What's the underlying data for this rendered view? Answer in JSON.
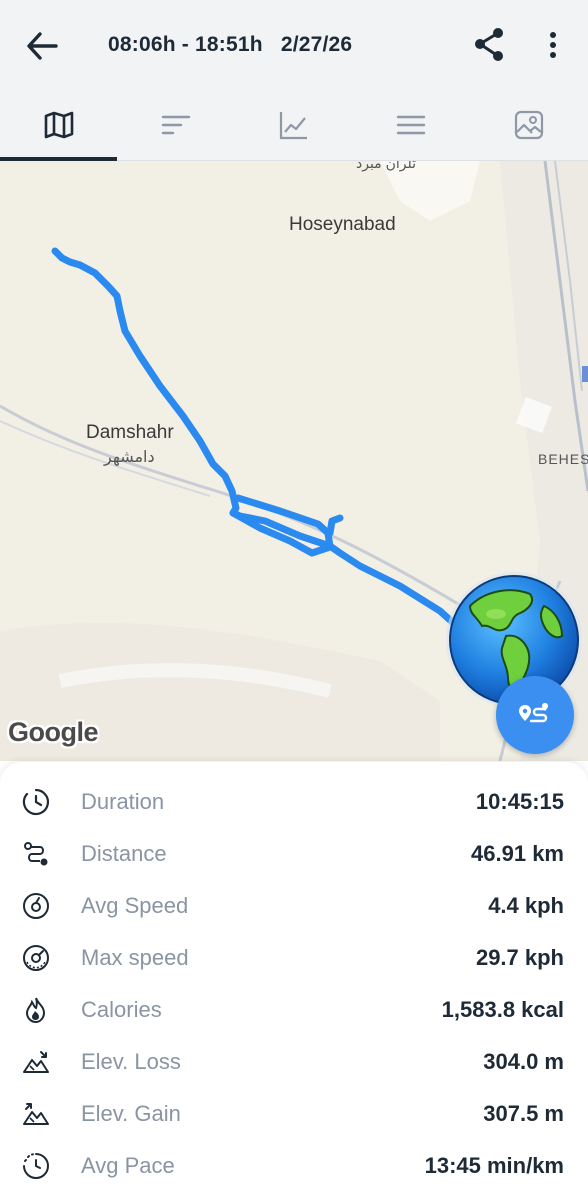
{
  "header": {
    "title": "08:06h - 18:51h   2/27/26",
    "back_icon": "arrow-left-icon",
    "share_icon": "share-icon",
    "more_icon": "more-vertical-icon"
  },
  "tabs": [
    {
      "icon": "map-icon",
      "selected": true
    },
    {
      "icon": "sort-lines-icon",
      "selected": false
    },
    {
      "icon": "chart-line-icon",
      "selected": false
    },
    {
      "icon": "menu-lines-icon",
      "selected": false
    },
    {
      "icon": "image-icon",
      "selected": false
    }
  ],
  "map": {
    "labels": {
      "hoseynabad": "Hoseynabad",
      "damshahr": "Damshahr",
      "damshahr_fa": "دامشهر",
      "behesh": "BEHES",
      "top_fa": "تلران مبرد"
    },
    "attribution": "Google",
    "route_color": "#2b8af0"
  },
  "stats": [
    {
      "icon": "clock-icon",
      "label": "Duration",
      "value": "10:45:15"
    },
    {
      "icon": "route-icon",
      "label": "Distance",
      "value": "46.91 km"
    },
    {
      "icon": "speed-gauge-icon",
      "label": "Avg Speed",
      "value": "4.4 kph"
    },
    {
      "icon": "speed-max-icon",
      "label": "Max speed",
      "value": "29.7 kph"
    },
    {
      "icon": "flame-icon",
      "label": "Calories",
      "value": "1,583.8 kcal"
    },
    {
      "icon": "elevation-loss-icon",
      "label": "Elev. Loss",
      "value": "304.0 m"
    },
    {
      "icon": "elevation-gain-icon",
      "label": "Elev. Gain",
      "value": "307.5 m"
    },
    {
      "icon": "pace-clock-icon",
      "label": "Avg Pace",
      "value": "13:45 min/km"
    }
  ]
}
